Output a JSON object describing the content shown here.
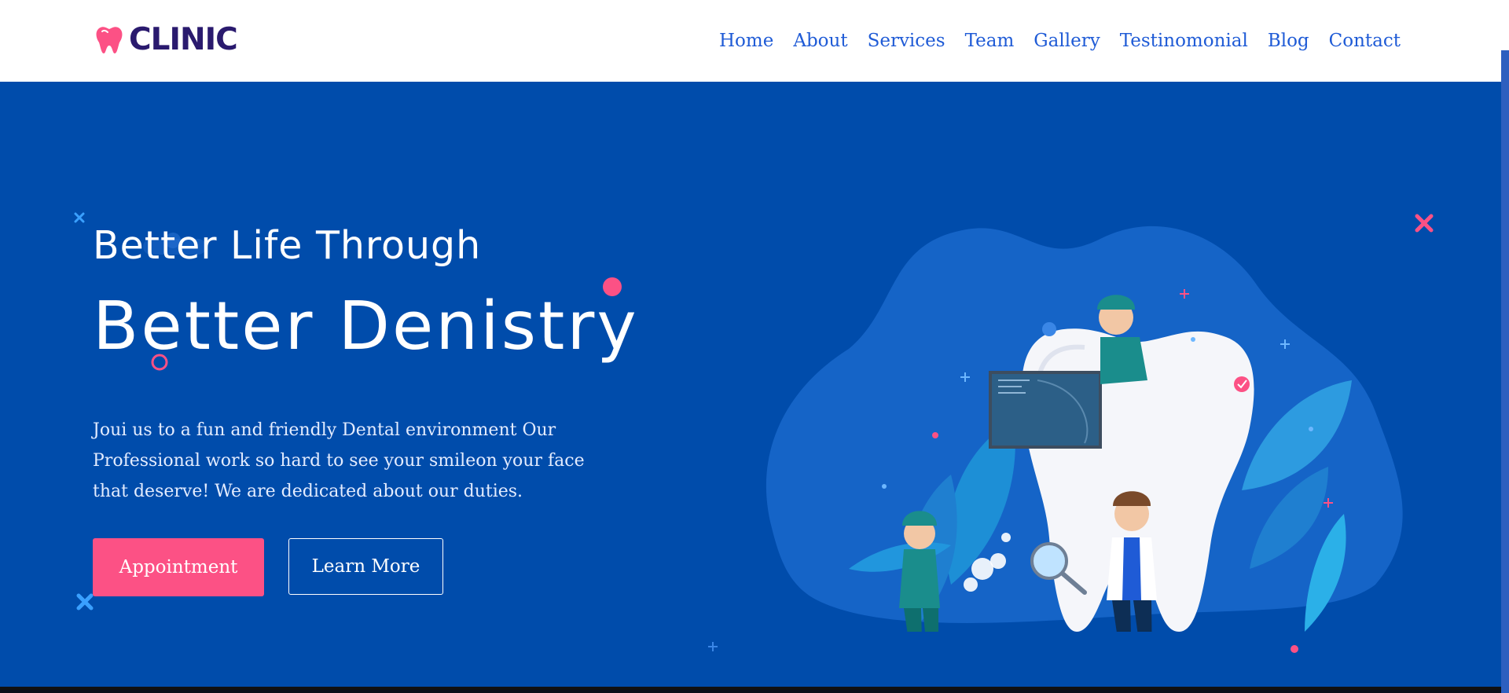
{
  "brand": {
    "name": "CLINIC",
    "accent": "#fc5185",
    "dark": "#2a1a6e"
  },
  "nav": {
    "items": [
      "Home",
      "About",
      "Services",
      "Team",
      "Gallery",
      "Testinomonial",
      "Blog",
      "Contact"
    ],
    "color": "#1f5bd6"
  },
  "hero": {
    "background": "#004cab",
    "subtitle": "Better Life Through",
    "title": "Better Denistry",
    "description": "Joui us to a fun and friendly Dental environment Our Professional work so hard to see your smileon your face that deserve! We are dedicated about our duties.",
    "primary_button": "Appointment",
    "secondary_button": "Learn More",
    "illustration": "dentists-with-giant-tooth-illustration"
  },
  "icons": {
    "logo": "tooth-icon",
    "decorations": [
      "plus-icon",
      "cross-icon",
      "dot-icon",
      "ring-icon",
      "check-badge-icon"
    ]
  }
}
